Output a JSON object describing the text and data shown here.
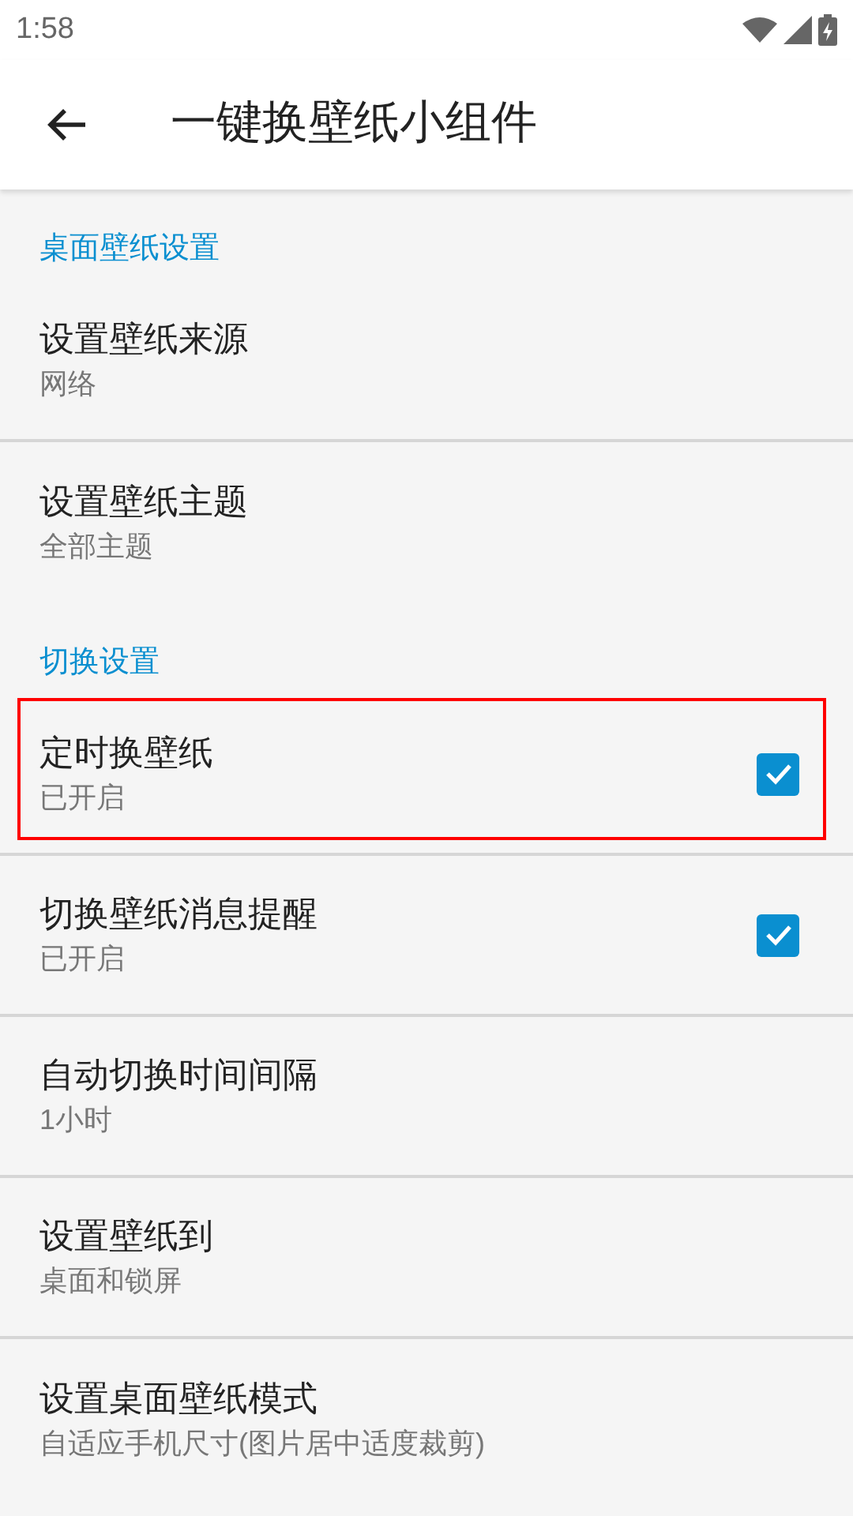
{
  "status_bar": {
    "time": "1:58"
  },
  "app_bar": {
    "title": "一键换壁纸小组件"
  },
  "sections": [
    {
      "header": "桌面壁纸设置",
      "items": [
        {
          "kind": "plain",
          "title": "设置壁纸来源",
          "summary": "网络",
          "highlighted": false
        },
        {
          "kind": "plain",
          "title": "设置壁纸主题",
          "summary": "全部主题",
          "highlighted": false
        }
      ]
    },
    {
      "header": "切换设置",
      "items": [
        {
          "kind": "checkbox",
          "title": "定时换壁纸",
          "summary": "已开启",
          "checked": true,
          "highlighted": true
        },
        {
          "kind": "checkbox",
          "title": "切换壁纸消息提醒",
          "summary": "已开启",
          "checked": true,
          "highlighted": false
        },
        {
          "kind": "plain",
          "title": "自动切换时间间隔",
          "summary": "1小时",
          "highlighted": false
        },
        {
          "kind": "plain",
          "title": "设置壁纸到",
          "summary": "桌面和锁屏",
          "highlighted": false
        },
        {
          "kind": "plain",
          "title": "设置桌面壁纸模式",
          "summary": "自适应手机尺寸(图片居中适度裁剪)",
          "highlighted": false
        }
      ]
    }
  ]
}
